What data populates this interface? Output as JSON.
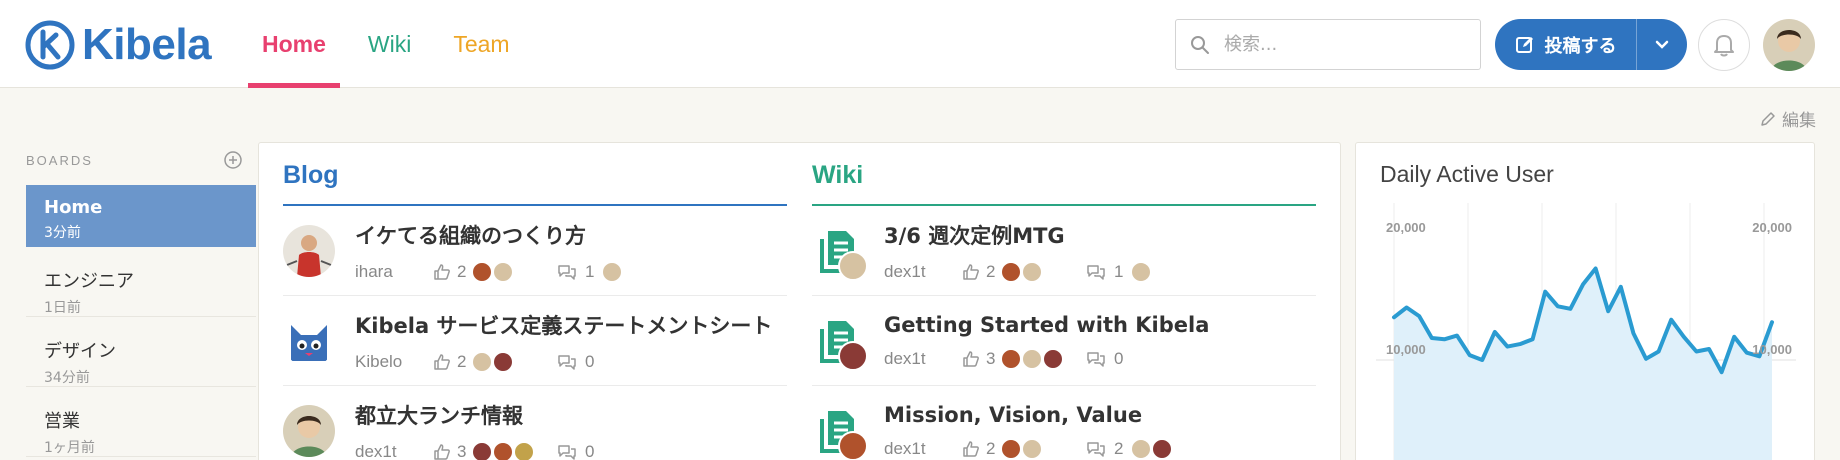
{
  "header": {
    "logo_text": "Kibela",
    "tabs": [
      {
        "label": "Home"
      },
      {
        "label": "Wiki"
      },
      {
        "label": "Team"
      }
    ],
    "search_placeholder": "検索...",
    "post_label": "投稿する"
  },
  "edit_label": "編集",
  "sidebar": {
    "heading": "BOARDS",
    "items": [
      {
        "name": "Home",
        "time": "3分前"
      },
      {
        "name": "エンジニア",
        "time": "1日前"
      },
      {
        "name": "デザイン",
        "time": "34分前"
      },
      {
        "name": "営業",
        "time": "1ヶ月前"
      }
    ]
  },
  "blog": {
    "title": "Blog",
    "entries": [
      {
        "title": "イケてる組織のつくり方",
        "author": "ihara",
        "likes": "2",
        "comments": "1"
      },
      {
        "title": "Kibela サービス定義ステートメントシート",
        "author": "Kibelo",
        "likes": "2",
        "comments": "0"
      },
      {
        "title": "都立大ランチ情報",
        "author": "dex1t",
        "likes": "3",
        "comments": "0"
      }
    ]
  },
  "wiki": {
    "title": "Wiki",
    "entries": [
      {
        "title": "3/6 週次定例MTG",
        "author": "dex1t",
        "likes": "2",
        "comments": "1"
      },
      {
        "title": "Getting Started with Kibela",
        "author": "dex1t",
        "likes": "3",
        "comments": "0"
      },
      {
        "title": "Mission, Vision, Value",
        "author": "dex1t",
        "likes": "2",
        "comments": "2"
      }
    ]
  },
  "chart_data": {
    "type": "area",
    "title": "Daily Active User",
    "ytick_labels_left": [
      "20,000",
      "10,000"
    ],
    "ytick_labels_right": [
      "20,000",
      "10,000"
    ],
    "ylim": [
      0,
      21000
    ],
    "values": [
      13500,
      14300,
      13600,
      11800,
      11700,
      12000,
      10400,
      10000,
      12300,
      11100,
      11300,
      11700,
      15600,
      14400,
      14200,
      16200,
      17500,
      14000,
      16000,
      12200,
      10100,
      10700,
      13300,
      11900,
      10700,
      10900,
      9000,
      11900,
      10600,
      10300,
      13100
    ],
    "colors": {
      "line": "#2a9bd1",
      "fill": "#dff0fa"
    }
  }
}
